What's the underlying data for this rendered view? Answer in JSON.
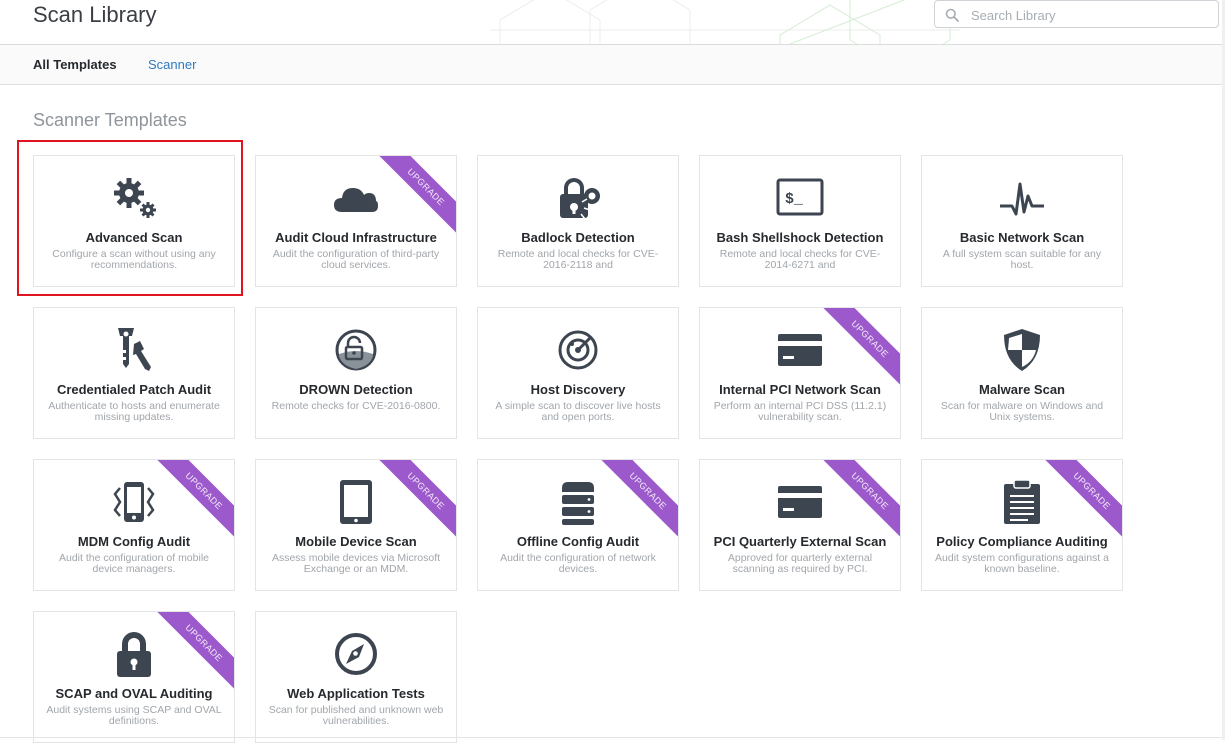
{
  "header": {
    "title": "Scan Library",
    "search_placeholder": "Search Library",
    "search_value": ""
  },
  "tabs": [
    {
      "label": "All Templates",
      "active": true
    },
    {
      "label": "Scanner",
      "active": false
    }
  ],
  "section_title": "Scanner Templates",
  "colors": {
    "upgrade_ribbon": "#9c59cc",
    "icon": "#3d4650",
    "highlight": "#e0141e",
    "link": "#2f7bbf"
  },
  "upgrade_label": "UPGRADE",
  "templates": [
    {
      "title": "Advanced Scan",
      "desc": "Configure a scan without using any recommendations.",
      "icon": "gears-icon",
      "upgrade": false,
      "highlighted": true
    },
    {
      "title": "Audit Cloud Infrastructure",
      "desc": "Audit the configuration of third-party cloud services.",
      "icon": "cloud-icon",
      "upgrade": true
    },
    {
      "title": "Badlock Detection",
      "desc": "Remote and local checks for CVE-2016-2118 and",
      "icon": "badlock-icon",
      "upgrade": false
    },
    {
      "title": "Bash Shellshock Detection",
      "desc": "Remote and local checks for CVE-2014-6271 and",
      "icon": "terminal-icon",
      "upgrade": false
    },
    {
      "title": "Basic Network Scan",
      "desc": "A full system scan suitable for any host.",
      "icon": "pulse-icon",
      "upgrade": false
    },
    {
      "title": "Credentialed Patch Audit",
      "desc": "Authenticate to hosts and enumerate missing updates.",
      "icon": "keys-icon",
      "upgrade": false
    },
    {
      "title": "DROWN Detection",
      "desc": "Remote checks for CVE-2016-0800.",
      "icon": "drown-icon",
      "upgrade": false
    },
    {
      "title": "Host Discovery",
      "desc": "A simple scan to discover live hosts and open ports.",
      "icon": "radar-icon",
      "upgrade": false
    },
    {
      "title": "Internal PCI Network Scan",
      "desc": "Perform an internal PCI DSS (11.2.1) vulnerability scan.",
      "icon": "credit-card-icon",
      "upgrade": true
    },
    {
      "title": "Malware Scan",
      "desc": "Scan for malware on Windows and Unix systems.",
      "icon": "shield-icon",
      "upgrade": false
    },
    {
      "title": "MDM Config Audit",
      "desc": "Audit the configuration of mobile device managers.",
      "icon": "mobile-vibrate-icon",
      "upgrade": true
    },
    {
      "title": "Mobile Device Scan",
      "desc": "Assess mobile devices via Microsoft Exchange or an MDM.",
      "icon": "tablet-icon",
      "upgrade": true
    },
    {
      "title": "Offline Config Audit",
      "desc": "Audit the configuration of network devices.",
      "icon": "server-stack-icon",
      "upgrade": true
    },
    {
      "title": "PCI Quarterly External Scan",
      "desc": "Approved for quarterly external scanning as required by PCI.",
      "icon": "credit-card-icon",
      "upgrade": true
    },
    {
      "title": "Policy Compliance Auditing",
      "desc": "Audit system configurations against a known baseline.",
      "icon": "clipboard-icon",
      "upgrade": true
    },
    {
      "title": "SCAP and OVAL Auditing",
      "desc": "Audit systems using SCAP and OVAL definitions.",
      "icon": "lock-icon",
      "upgrade": true
    },
    {
      "title": "Web Application Tests",
      "desc": "Scan for published and unknown web vulnerabilities.",
      "icon": "compass-icon",
      "upgrade": false
    }
  ]
}
